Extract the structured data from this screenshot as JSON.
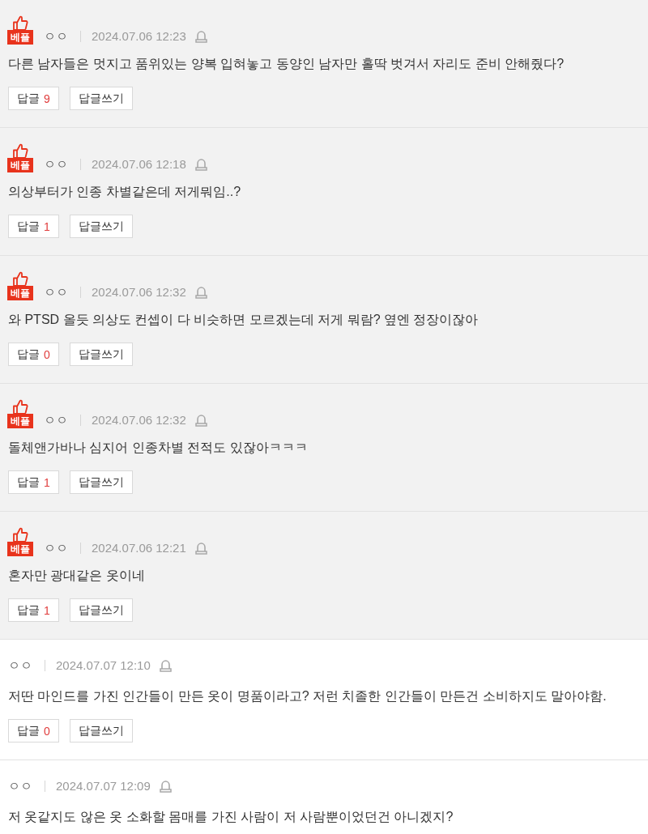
{
  "comments": [
    {
      "best": true,
      "badge": "베플",
      "nickname": "ㅇㅇ",
      "date": "2024.07.06 12:23",
      "text": "다른 남자들은 멋지고 품위있는 양복 입혀놓고 동양인 남자만 홀딱 벗겨서 자리도 준비 안해줬다?",
      "reply_button": {
        "label": "답글",
        "count": "9"
      },
      "write_button": "답글쓰기"
    },
    {
      "best": true,
      "badge": "베플",
      "nickname": "ㅇㅇ",
      "date": "2024.07.06 12:18",
      "text": "의상부터가 인종 차별같은데 저게뭐임..?",
      "reply_button": {
        "label": "답글",
        "count": "1"
      },
      "write_button": "답글쓰기"
    },
    {
      "best": true,
      "badge": "베플",
      "nickname": "ㅇㅇ",
      "date": "2024.07.06 12:32",
      "text": "와 PTSD 올듯 의상도 컨셉이 다 비슷하면 모르겠는데 저게 뭐람? 옆엔 정장이잖아",
      "reply_button": {
        "label": "답글",
        "count": "0"
      },
      "write_button": "답글쓰기"
    },
    {
      "best": true,
      "badge": "베플",
      "nickname": "ㅇㅇ",
      "date": "2024.07.06 12:32",
      "text": "돌체앤가바나 심지어 인종차별 전적도 있잖아ㅋㅋㅋ",
      "reply_button": {
        "label": "답글",
        "count": "1"
      },
      "write_button": "답글쓰기"
    },
    {
      "best": true,
      "badge": "베플",
      "nickname": "ㅇㅇ",
      "date": "2024.07.06 12:21",
      "text": "혼자만 광대같은 옷이네",
      "reply_button": {
        "label": "답글",
        "count": "1"
      },
      "write_button": "답글쓰기"
    },
    {
      "best": false,
      "nickname": "ㅇㅇ",
      "date": "2024.07.07 12:10",
      "text": "저딴 마인드를 가진 인간들이 만든 옷이 명품이라고? 저런 치졸한 인간들이 만든건 소비하지도 말아야함.",
      "reply_button": {
        "label": "답글",
        "count": "0"
      },
      "write_button": "답글쓰기"
    },
    {
      "best": false,
      "nickname": "ㅇㅇ",
      "date": "2024.07.07 12:09",
      "text": "저 옷같지도 않은 옷 소화할 몸매를 가진 사람이 저 사람뿐이었던건 아니겠지?"
    }
  ]
}
